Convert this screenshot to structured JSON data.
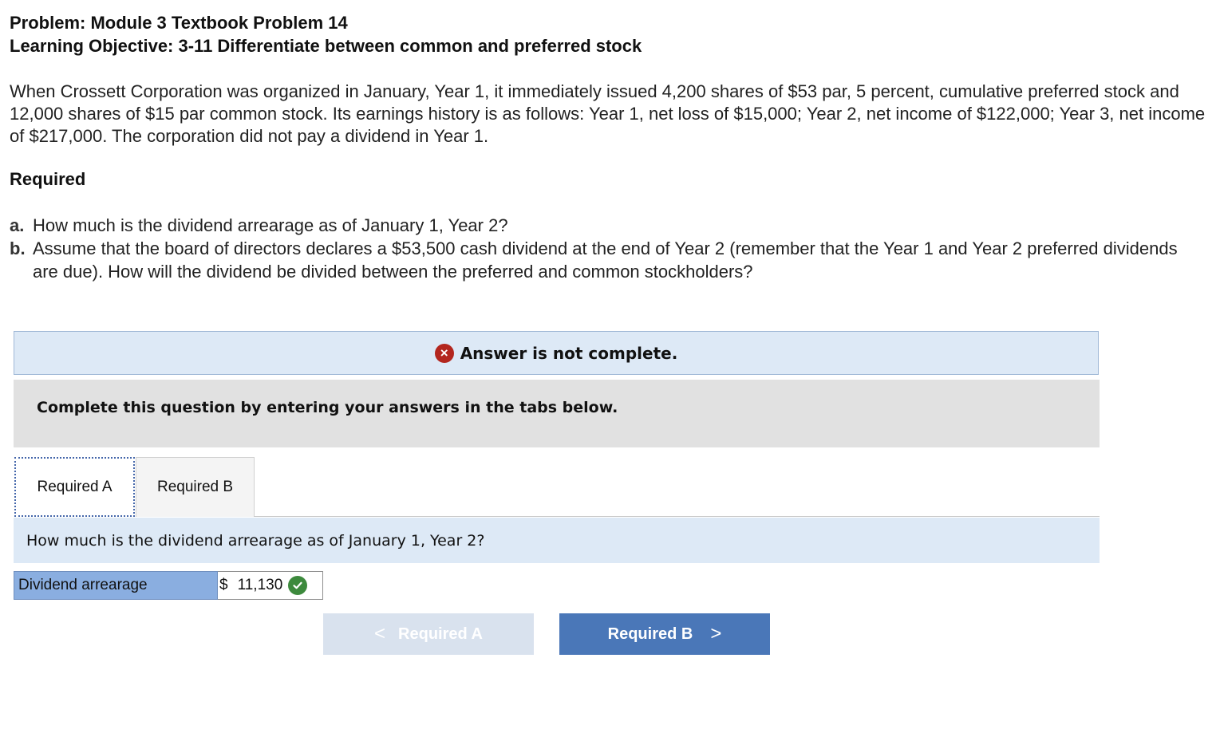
{
  "header": {
    "problem": "Problem: Module 3 Textbook Problem 14",
    "objective": "Learning Objective: 3-11 Differentiate between common and preferred stock"
  },
  "intro_text": "When Crossett Corporation was organized in January, Year 1, it immediately issued 4,200 shares of $53 par, 5 percent, cumulative preferred stock and 12,000 shares of $15 par common stock. Its earnings history is as follows: Year 1, net loss of $15,000; Year 2, net income of $122,000; Year 3, net income of $217,000. The corporation did not pay a dividend in Year 1.",
  "required_heading": "Required",
  "questions": [
    {
      "letter": "a.",
      "text": "How much is the dividend arrearage as of January 1, Year 2?"
    },
    {
      "letter": "b.",
      "text": "Assume that the board of directors declares a $53,500 cash dividend at the end of Year 2 (remember that the Year 1 and Year 2 preferred dividends are due). How will the dividend be divided between the preferred and common stockholders?"
    }
  ],
  "status": {
    "icon": "x-circle-icon",
    "icon_glyph": "×",
    "text": "Answer is not complete.",
    "color": "#b3261e"
  },
  "instructions": "Complete this question by entering your answers in the tabs below.",
  "tabs": [
    {
      "label": "Required A",
      "active": true
    },
    {
      "label": "Required B",
      "active": false
    }
  ],
  "tab_question": "How much is the dividend arrearage as of January 1, Year 2?",
  "answer": {
    "label": "Dividend arrearage",
    "currency": "$",
    "value": "11,130",
    "correct": true
  },
  "nav": {
    "prev_label": "Required A",
    "prev_chevron": "<",
    "next_label": "Required B",
    "next_chevron": ">"
  },
  "colors": {
    "accent": "#4a77b8",
    "status_bg": "#dde9f6",
    "label_bg": "#8aaee0",
    "correct": "#3d8a3d"
  }
}
